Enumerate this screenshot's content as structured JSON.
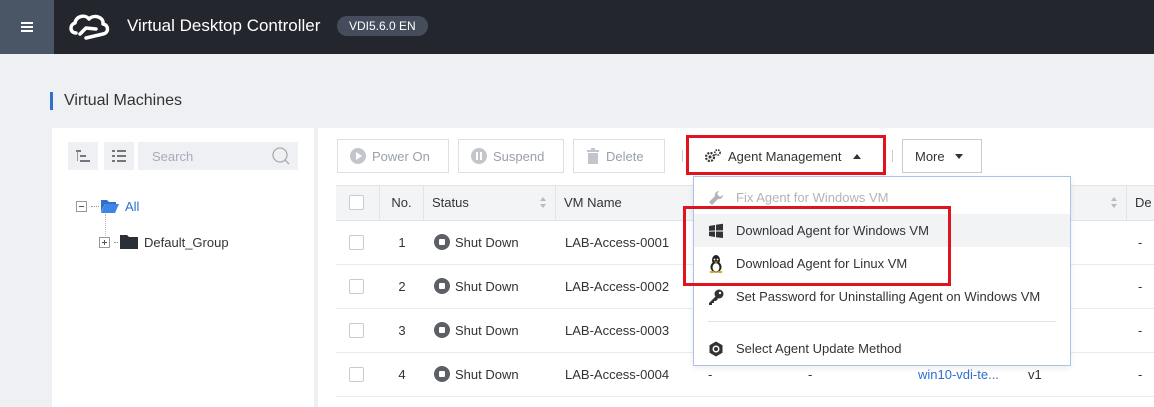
{
  "header": {
    "app_title": "Virtual Desktop Controller",
    "version": "VDI5.6.0 EN"
  },
  "page": {
    "title": "Virtual Machines"
  },
  "tree": {
    "search_placeholder": "Search",
    "nodes": [
      {
        "label": "All"
      },
      {
        "label": "Default_Group"
      }
    ]
  },
  "toolbar": {
    "power_on": "Power On",
    "suspend": "Suspend",
    "delete": "Delete",
    "agent_management": "Agent Management",
    "more": "More"
  },
  "table": {
    "columns": [
      "No.",
      "Status",
      "VM Name",
      "De"
    ],
    "rows": [
      {
        "no": "1",
        "status": "Shut Down",
        "vm_name": "LAB-Access-0001",
        "c1": "",
        "c2": "",
        "template": "",
        "ver": "",
        "last": "-"
      },
      {
        "no": "2",
        "status": "Shut Down",
        "vm_name": "LAB-Access-0002",
        "c1": "",
        "c2": "",
        "template": "",
        "ver": "",
        "last": "-"
      },
      {
        "no": "3",
        "status": "Shut Down",
        "vm_name": "LAB-Access-0003",
        "c1": "",
        "c2": "",
        "template": "",
        "ver": "",
        "last": "-"
      },
      {
        "no": "4",
        "status": "Shut Down",
        "vm_name": "LAB-Access-0004",
        "c1": "-",
        "c2": "-",
        "template": "win10-vdi-te...",
        "ver": "v1",
        "last": "-"
      }
    ]
  },
  "agent_menu": {
    "items": [
      {
        "label": "Fix Agent for Windows VM",
        "icon": "wrench-icon",
        "enabled": false
      },
      {
        "label": "Download Agent for Windows VM",
        "icon": "windows-icon",
        "enabled": true
      },
      {
        "label": "Download Agent for Linux VM",
        "icon": "linux-icon",
        "enabled": true
      },
      {
        "label": "Set Password for Uninstalling Agent on Windows VM",
        "icon": "key-icon",
        "enabled": true
      },
      {
        "label": "Select Agent Update Method",
        "icon": "update-method-icon",
        "enabled": true
      }
    ]
  },
  "colors": {
    "accent": "#2f6fd0",
    "topbar": "#23262d",
    "highlight": "#e0141e"
  }
}
